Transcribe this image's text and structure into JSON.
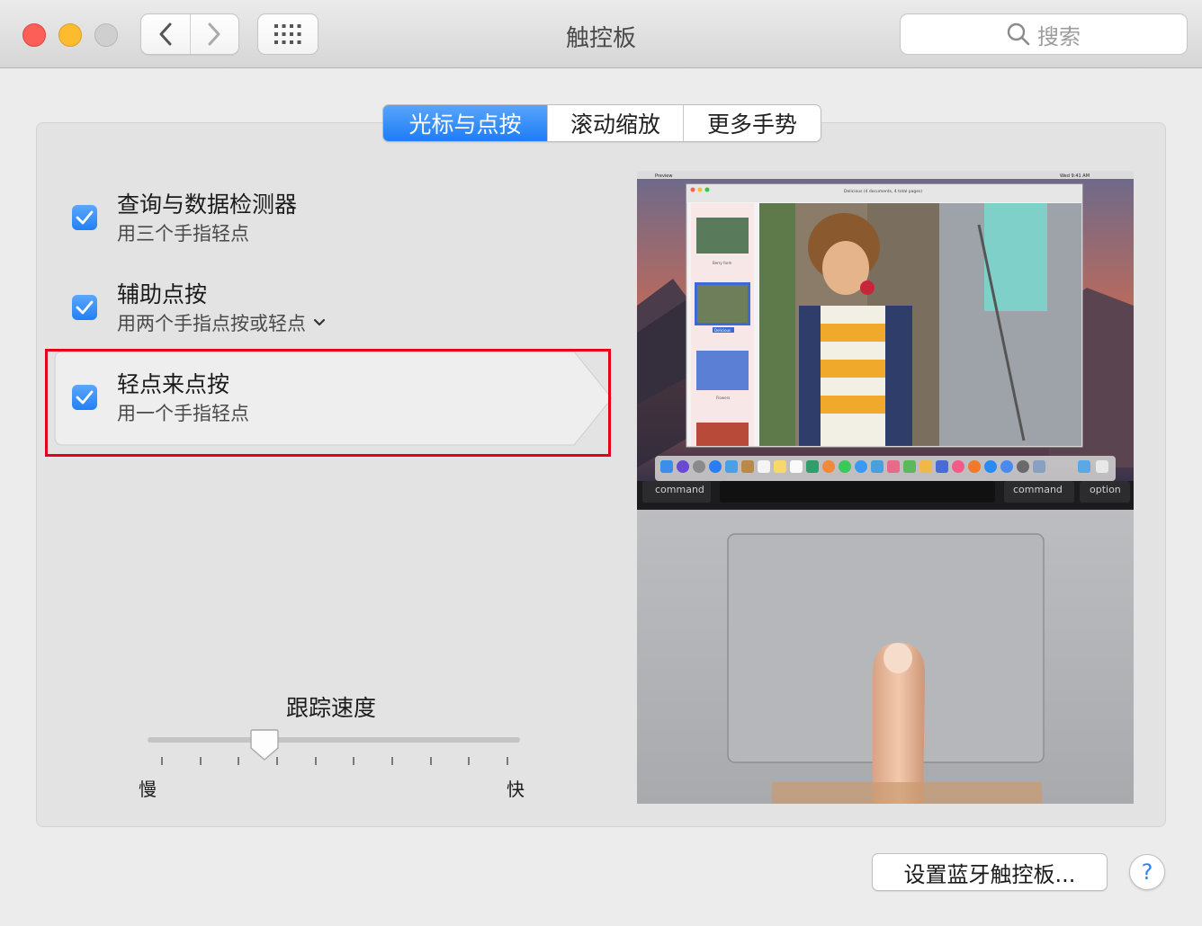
{
  "window": {
    "title": "触控板"
  },
  "search": {
    "placeholder": "搜索"
  },
  "tabs": [
    {
      "label": "光标与点按",
      "active": true
    },
    {
      "label": "滚动缩放",
      "active": false
    },
    {
      "label": "更多手势",
      "active": false
    }
  ],
  "options": [
    {
      "title": "查询与数据检测器",
      "subtitle": "用三个手指轻点",
      "checked": true,
      "has_dropdown": false,
      "selected": false
    },
    {
      "title": "辅助点按",
      "subtitle": "用两个手指点按或轻点",
      "checked": true,
      "has_dropdown": true,
      "selected": false
    },
    {
      "title": "轻点来点按",
      "subtitle": "用一个手指轻点",
      "checked": true,
      "has_dropdown": false,
      "selected": true
    }
  ],
  "tracking": {
    "label": "跟踪速度",
    "min_label": "慢",
    "max_label": "快",
    "value_fraction": 0.3,
    "tick_count": 10
  },
  "preview": {
    "menubar": {
      "app": "Preview",
      "time": "Wed 9:41 AM"
    },
    "doc_title": "Delicious (4 documents, 4 total pages)",
    "thumbnails": [
      "Berry farm",
      "Delicious",
      "Flowers"
    ],
    "keys": [
      "command",
      "command",
      "option"
    ]
  },
  "buttons": {
    "bluetooth": "设置蓝牙触控板...",
    "help": "?"
  },
  "colors": {
    "accent": "#1d7df7",
    "highlight": "#e4001a"
  }
}
